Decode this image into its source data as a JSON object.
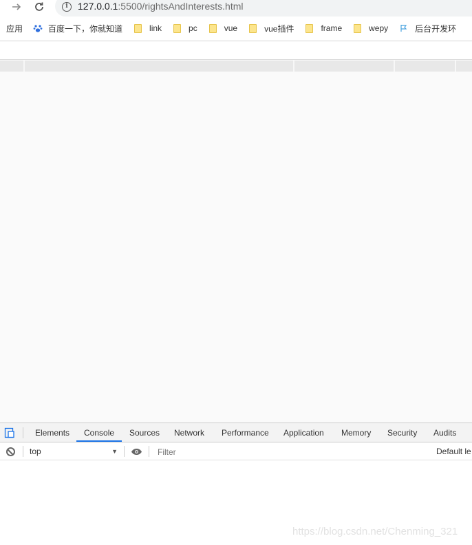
{
  "toolbar": {
    "forward_icon": "arrow-right-icon",
    "reload_icon": "reload-icon",
    "url_host": "127.0.0.1",
    "url_rest": ":5500/rightsAndInterests.html"
  },
  "bookmarks": {
    "apps_label": "应用",
    "items": [
      {
        "label": "百度一下，你就知道",
        "icon": "baidu-paw-icon"
      },
      {
        "label": "link",
        "icon": "folder-icon"
      },
      {
        "label": "pc",
        "icon": "folder-icon"
      },
      {
        "label": "vue",
        "icon": "folder-icon"
      },
      {
        "label": "vue插件",
        "icon": "folder-icon"
      },
      {
        "label": "frame",
        "icon": "folder-icon"
      },
      {
        "label": "wepy",
        "icon": "folder-icon"
      },
      {
        "label": "后台开发环",
        "icon": "flag-icon"
      }
    ]
  },
  "devtools": {
    "tabs": [
      "Elements",
      "Console",
      "Sources",
      "Network",
      "Performance",
      "Application",
      "Memory",
      "Security",
      "Audits"
    ],
    "active_tab": "Console",
    "context": "top",
    "filter_placeholder": "Filter",
    "levels_label": "Default le"
  },
  "watermark": "https://blog.csdn.net/Chenming_321",
  "colors": {
    "active_tab_underline": "#1a73e8",
    "folder": "#fce58d",
    "viewport_bg": "#fafafa"
  }
}
